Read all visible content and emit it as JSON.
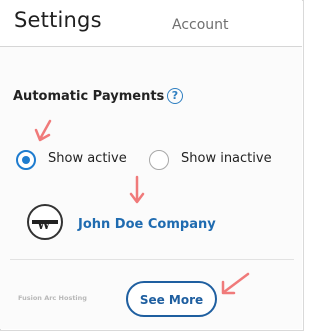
{
  "header": {
    "title": "Settings",
    "tab_account": "Account"
  },
  "section": {
    "title": "Automatic Payments",
    "help_icon": "?"
  },
  "radios": {
    "active_label": "Show active",
    "inactive_label": "Show inactive",
    "selected": "active"
  },
  "company": {
    "name": "John Doe Company",
    "logo_icon": "company-logo-icon"
  },
  "footer": {
    "brand": "Fusion Arc Hosting",
    "see_more_label": "See More"
  },
  "colors": {
    "accent": "#1e7ccf",
    "link": "#1f6bb0",
    "annotation_arrow": "#f07a7a"
  }
}
